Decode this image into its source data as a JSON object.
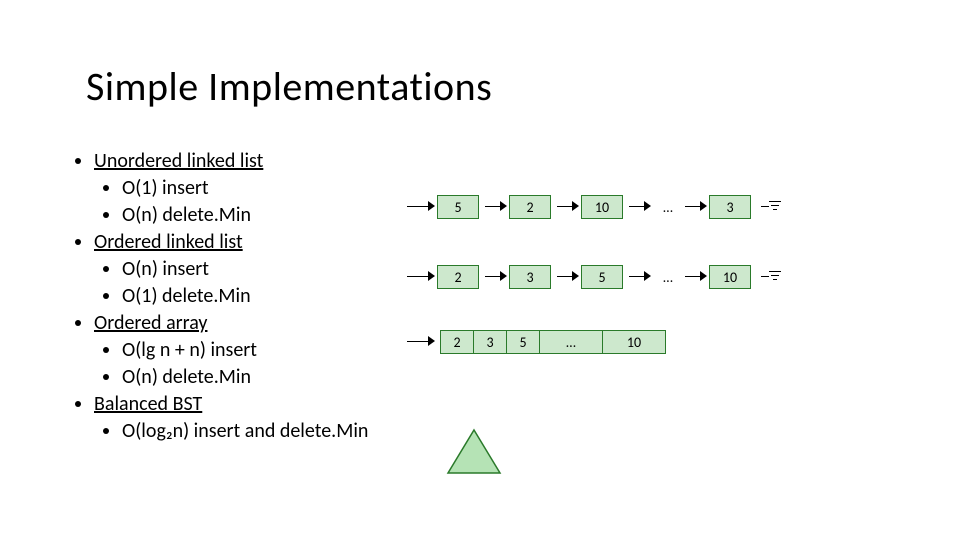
{
  "title": "Simple Implementations",
  "bullets": [
    {
      "label": "Unordered linked list",
      "underline": true,
      "sub": [
        "O(1) insert",
        "O(n) delete.Min"
      ]
    },
    {
      "label": "Ordered linked list",
      "underline": true,
      "sub": [
        "O(n) insert",
        "O(1) delete.Min"
      ]
    },
    {
      "label": "Ordered array",
      "underline": true,
      "sub": [
        "O(lg n + n) insert",
        "O(n) delete.Min"
      ]
    },
    {
      "label": "Balanced BST",
      "underline": true,
      "sub": [
        "O(log₂n) insert and delete.Min"
      ]
    }
  ],
  "list1": {
    "nodes": [
      "5",
      "2",
      "10"
    ],
    "dots": "…",
    "last": "3"
  },
  "list2": {
    "nodes": [
      "2",
      "3",
      "5"
    ],
    "dots": "…",
    "last": "10"
  },
  "array": {
    "cells": [
      "2",
      "3",
      "5",
      "…",
      "10"
    ]
  }
}
